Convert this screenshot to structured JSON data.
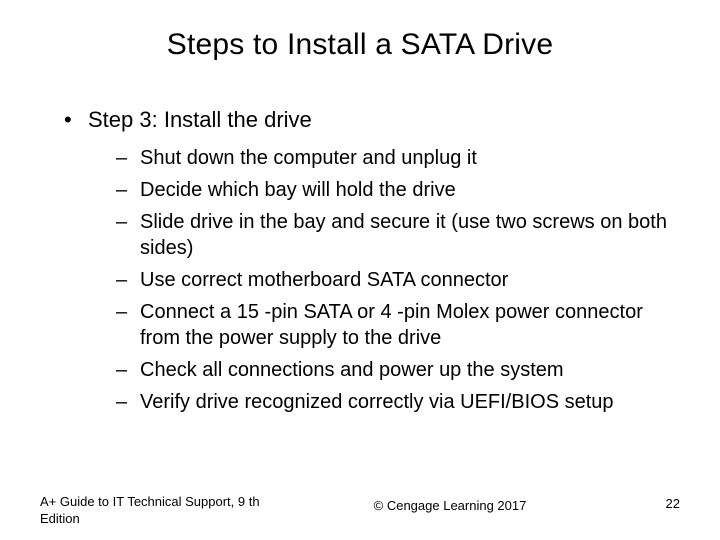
{
  "title": "Steps to Install a SATA Drive",
  "step": {
    "label": "Step 3: Install the drive",
    "sub": [
      "Shut down the computer and unplug it",
      "Decide which bay will hold the drive",
      "Slide drive in the bay and secure it (use two screws on both sides)",
      "Use correct motherboard SATA connector",
      "Connect a 15 -pin SATA or 4 -pin Molex power connector from the power supply to the drive",
      "Check all connections and power up the system",
      "Verify drive recognized correctly via UEFI/BIOS setup"
    ]
  },
  "footer": {
    "left": "A+ Guide to IT Technical Support, 9 th Edition",
    "center": "© Cengage Learning  2017",
    "right": "22"
  }
}
